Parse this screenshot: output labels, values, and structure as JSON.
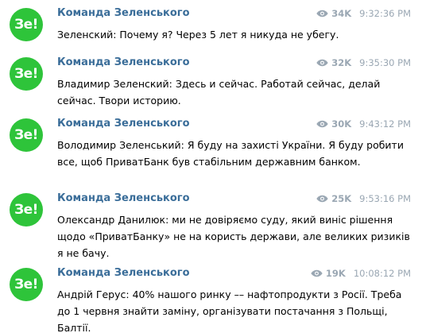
{
  "messages": [
    {
      "avatar": "Зе!",
      "author": "Команда Зеленського",
      "views": "34K",
      "time": "9:32:36 PM",
      "text": "Зеленский: Почему я? Через 5 лет я никуда не убегу."
    },
    {
      "avatar": "Зе!",
      "author": "Команда Зеленського",
      "views": "32K",
      "time": "9:35:30 PM",
      "text": "Владимир Зеленский: Здесь и сейчас. Работай сейчас, делай сейчас. Твори историю."
    },
    {
      "avatar": "Зе!",
      "author": "Команда Зеленського",
      "views": "30K",
      "time": "9:43:12 PM",
      "text": "Володимир Зеленський: Я буду на захисті України. Я буду робити все, щоб ПриватБанк був стабільним державним банком."
    },
    {
      "avatar": "Зе!",
      "author": "Команда Зеленського",
      "views": "25K",
      "time": "9:53:16 PM",
      "text": "Олександр Данилюк: ми не довіряємо суду, який виніс рішення щодо «ПриватБанку» не на користь держави, але великих ризиків я не бачу."
    },
    {
      "avatar": "Зе!",
      "author": "Команда Зеленського",
      "views": "19K",
      "time": "10:08:12 PM",
      "text": "Андрій Герус: 40% нашого ринку –– нафтопродукти з Росії. Треба до 1 червня знайти заміну, організувати постачання з Польщі, Балтії."
    }
  ],
  "icons": {
    "views": "eye-icon"
  },
  "colors": {
    "avatar_bg": "#2ec43a",
    "author": "#3a6d99",
    "meta": "#9aa7b3",
    "text": "#000000"
  }
}
